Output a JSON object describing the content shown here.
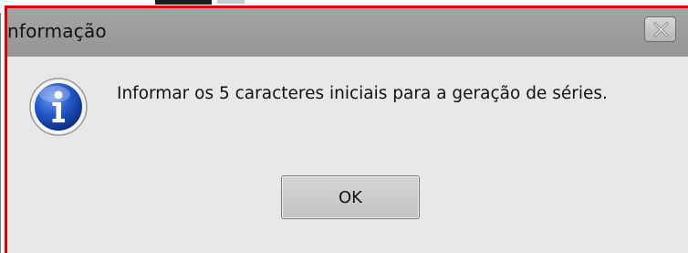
{
  "dialog": {
    "title": "nformação",
    "message": "Informar os 5 caracteres iniciais para a geração de séries.",
    "ok_label": "OK",
    "icons": {
      "close": "close-icon",
      "info": "information-icon"
    }
  },
  "colors": {
    "highlight_border": "#e60000",
    "titlebar": "#9e9e9e",
    "body": "#e8e8e8",
    "info_icon": "#1c4fb8"
  }
}
